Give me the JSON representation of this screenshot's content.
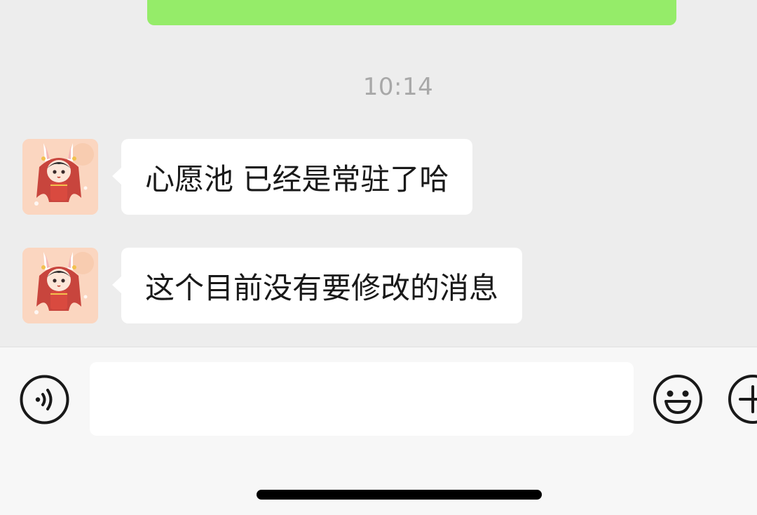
{
  "chat": {
    "timestamp": "10:14",
    "messages": [
      {
        "text": "心愿池 已经是常驻了哈"
      },
      {
        "text": "这个目前没有要修改的消息"
      }
    ]
  },
  "input_bar": {
    "placeholder": "",
    "voice_icon": "voice-icon",
    "emoji_icon": "emoji-icon",
    "plus_icon": "plus-icon"
  },
  "colors": {
    "chat_background": "#ededed",
    "outgoing_bubble": "#95ec69",
    "incoming_bubble": "#ffffff",
    "input_bar_background": "#f7f7f7"
  }
}
